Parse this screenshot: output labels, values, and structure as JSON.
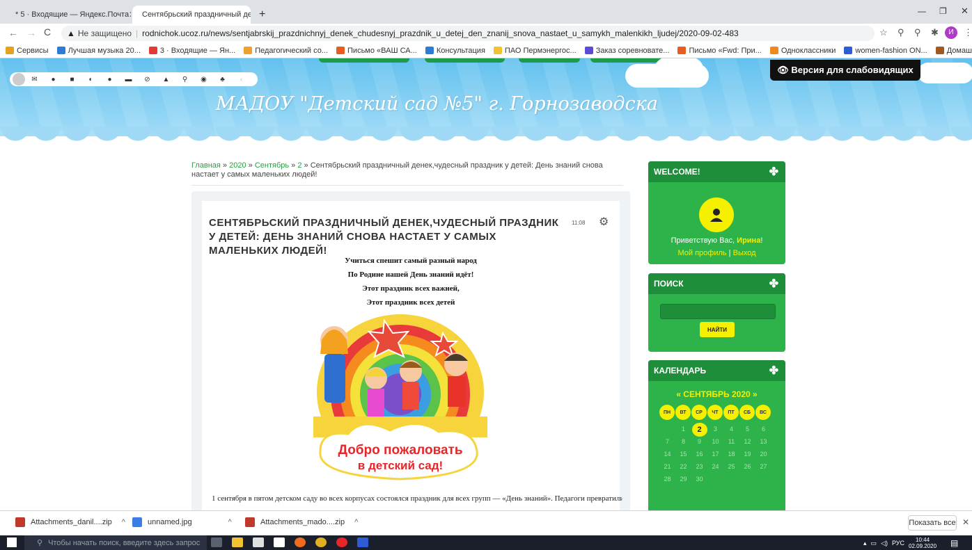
{
  "browser": {
    "tabs": [
      {
        "label": "* 5 · Входящие — Яндекс.Почта",
        "color": "#e53935"
      },
      {
        "label": "Сентябрьский праздничный де",
        "color": "#3b7de6"
      }
    ],
    "new_tab": "+",
    "address": {
      "security": "Не защищено",
      "url": "rodnichok.ucoz.ru/news/sentjabrskij_prazdnichnyj_denek_chudesnyj_prazdnik_u_detej_den_znanij_snova_nastaet_u_samykh_malenkikh_ljudej/2020-09-02-483"
    },
    "bookmarks": [
      {
        "label": "Сервисы",
        "color": "#e8a020"
      },
      {
        "label": "Лучшая музыка 20...",
        "color": "#2e7bd6"
      },
      {
        "label": "3 · Входящие — Ян...",
        "color": "#e53935"
      },
      {
        "label": "Педагогический со...",
        "color": "#f0a030"
      },
      {
        "label": "Письмо «ВАШ СА...",
        "color": "#e85c20"
      },
      {
        "label": "Консультация",
        "color": "#2e7bd6"
      },
      {
        "label": "ПАО Пермэнергос...",
        "color": "#f2c230"
      },
      {
        "label": "Заказ соревновате...",
        "color": "#5c4bd6"
      },
      {
        "label": "Письмо «Fwd: При...",
        "color": "#e85c20"
      },
      {
        "label": "Одноклассники",
        "color": "#f08a20"
      },
      {
        "label": "women-fashion ON...",
        "color": "#2e5bd6"
      },
      {
        "label": "Домашняя - МДОУ...",
        "color": "#a05a20"
      }
    ],
    "profile_initial": "И"
  },
  "site": {
    "vision_button": "👁 Версия для слабовидящих",
    "title": "МАДОУ \"Детский сад №5\" г. Горнозаводска",
    "breadcrumb": {
      "home": "Главная",
      "sep": " » ",
      "year": "2020",
      "month": "Сентябрь",
      "day": "2",
      "current": "Сентябрьский праздничный денек,чудесный праздник у детей: День знаний снова настает у самых маленьких людей!"
    },
    "article": {
      "title": "СЕНТЯБРЬСКИЙ ПРАЗДНИЧНЫЙ ДЕНЕК,ЧУДЕСНЫЙ ПРАЗДНИК У ДЕТЕЙ: ДЕНЬ ЗНАНИЙ СНОВА НАСТАЕТ У САМЫХ МАЛЕНЬКИХ ЛЮДЕЙ!",
      "time": "11:08",
      "poem": [
        "Учиться спешит самый разный народ",
        "По Родине нашей День знаний идёт!",
        "Этот праздник всех важней,",
        "Этот праздник всех детей"
      ],
      "image_caption_line1": "Добро пожаловать",
      "image_caption_line2": "в детский сад!",
      "body": "1 сентября в  пятом детском саду во всех корпусах состоялся праздник для всех групп — «День знаний». Педагоги превратились"
    },
    "welcome": {
      "heading": "WELCOME!",
      "greeting_prefix": "Приветствую Вас, ",
      "user": "Ирина",
      "greeting_suffix": "!",
      "profile_link": "Мой профиль",
      "link_sep": " | ",
      "logout_link": "Выход"
    },
    "search": {
      "heading": "ПОИСК",
      "button": "НАЙТИ"
    },
    "calendar": {
      "heading": "КАЛЕНДАРЬ",
      "month": "« СЕНТЯБРЬ 2020 »",
      "weekdays": [
        "ПН",
        "ВТ",
        "СР",
        "ЧТ",
        "ПТ",
        "СБ",
        "ВС"
      ],
      "weeks": [
        [
          "",
          "1",
          "2",
          "3",
          "4",
          "5",
          "6"
        ],
        [
          "7",
          "8",
          "9",
          "10",
          "11",
          "12",
          "13"
        ],
        [
          "14",
          "15",
          "16",
          "17",
          "18",
          "19",
          "20"
        ],
        [
          "21",
          "22",
          "23",
          "24",
          "25",
          "26",
          "27"
        ],
        [
          "28",
          "29",
          "30",
          "",
          "",
          "",
          ""
        ]
      ],
      "today": "2"
    }
  },
  "downloads": {
    "items": [
      {
        "label": "Attachments_danil....zip",
        "color": "#c0392b"
      },
      {
        "label": "unnamed.jpg",
        "color": "#3b7de6"
      },
      {
        "label": "Attachments_mado....zip",
        "color": "#c0392b"
      }
    ],
    "show_all": "Показать все"
  },
  "taskbar": {
    "search_placeholder": "Чтобы начать поиск, введите здесь запрос",
    "lang": "РУС",
    "time": "10:44",
    "date": "02.09.2020"
  },
  "colors": {
    "brand_green": "#2db34a",
    "accent_yellow": "#f5ef00",
    "sky_blue": "#62c1ee"
  }
}
